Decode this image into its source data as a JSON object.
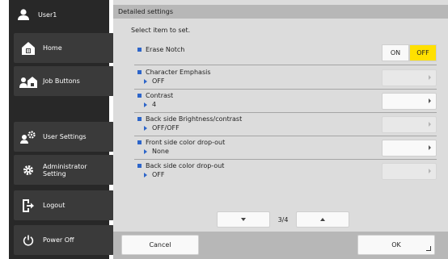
{
  "sidebar": {
    "user": {
      "label": "User1",
      "icon": "user-icon"
    },
    "buttons": [
      {
        "label": "Home",
        "icon": "home-icon"
      },
      {
        "label": "Job Buttons",
        "icon": "job-buttons-icon"
      },
      {
        "label": "User Settings",
        "icon": "user-settings-icon"
      },
      {
        "label": "Administrator\nSetting",
        "icon": "gear-icon"
      },
      {
        "label": "Logout",
        "icon": "logout-icon"
      },
      {
        "label": "Power Off",
        "icon": "power-icon"
      }
    ]
  },
  "header": {
    "title": "Detailed settings"
  },
  "prompt": "Select item to set.",
  "items": [
    {
      "name": "Erase Notch",
      "on_label": "ON",
      "off_label": "OFF",
      "selected": "OFF"
    },
    {
      "name": "Character Emphasis",
      "value": "OFF",
      "enabled": false
    },
    {
      "name": "Contrast",
      "value": "4",
      "enabled": true
    },
    {
      "name": "Back side Brightness/contrast",
      "value": "OFF/OFF",
      "enabled": false
    },
    {
      "name": "Front side color drop-out",
      "value": "None",
      "enabled": true
    },
    {
      "name": "Back side color drop-out",
      "value": "OFF",
      "enabled": false
    }
  ],
  "pager": {
    "label": "3/4"
  },
  "footer": {
    "cancel_label": "Cancel",
    "ok_label": "OK"
  },
  "colors": {
    "accent": "#2d65c9",
    "selected_toggle": "#ffe000",
    "sidebar_bg": "#282828"
  }
}
